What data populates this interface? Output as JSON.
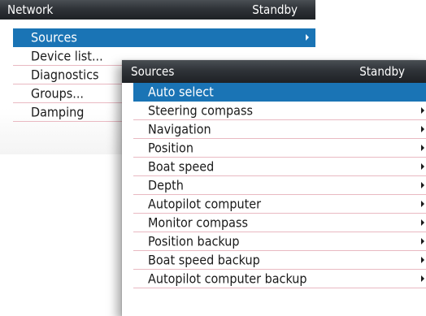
{
  "network_panel": {
    "title": "Network",
    "status": "Standby",
    "items": [
      {
        "label": "Sources",
        "selected": true,
        "has_submenu": true
      },
      {
        "label": "Device list...",
        "selected": false,
        "has_submenu": false
      },
      {
        "label": "Diagnostics",
        "selected": false,
        "has_submenu": false
      },
      {
        "label": "Groups...",
        "selected": false,
        "has_submenu": false
      },
      {
        "label": "Damping",
        "selected": false,
        "has_submenu": false
      }
    ]
  },
  "sources_panel": {
    "title": "Sources",
    "status": "Standby",
    "items": [
      {
        "label": "Auto select",
        "selected": true,
        "has_submenu": false
      },
      {
        "label": "Steering compass",
        "selected": false,
        "has_submenu": true
      },
      {
        "label": "Navigation",
        "selected": false,
        "has_submenu": true
      },
      {
        "label": "Position",
        "selected": false,
        "has_submenu": true
      },
      {
        "label": "Boat speed",
        "selected": false,
        "has_submenu": true
      },
      {
        "label": "Depth",
        "selected": false,
        "has_submenu": true
      },
      {
        "label": "Autopilot computer",
        "selected": false,
        "has_submenu": true
      },
      {
        "label": "Monitor compass",
        "selected": false,
        "has_submenu": true
      },
      {
        "label": "Position backup",
        "selected": false,
        "has_submenu": true
      },
      {
        "label": "Boat speed backup",
        "selected": false,
        "has_submenu": true
      },
      {
        "label": "Autopilot computer backup",
        "selected": false,
        "has_submenu": true
      }
    ]
  },
  "colors": {
    "titlebar": "#2f3338",
    "selection": "#1a74b5",
    "divider": "#e9b9c2"
  },
  "icons": {
    "submenu": "chevron-right-icon"
  }
}
